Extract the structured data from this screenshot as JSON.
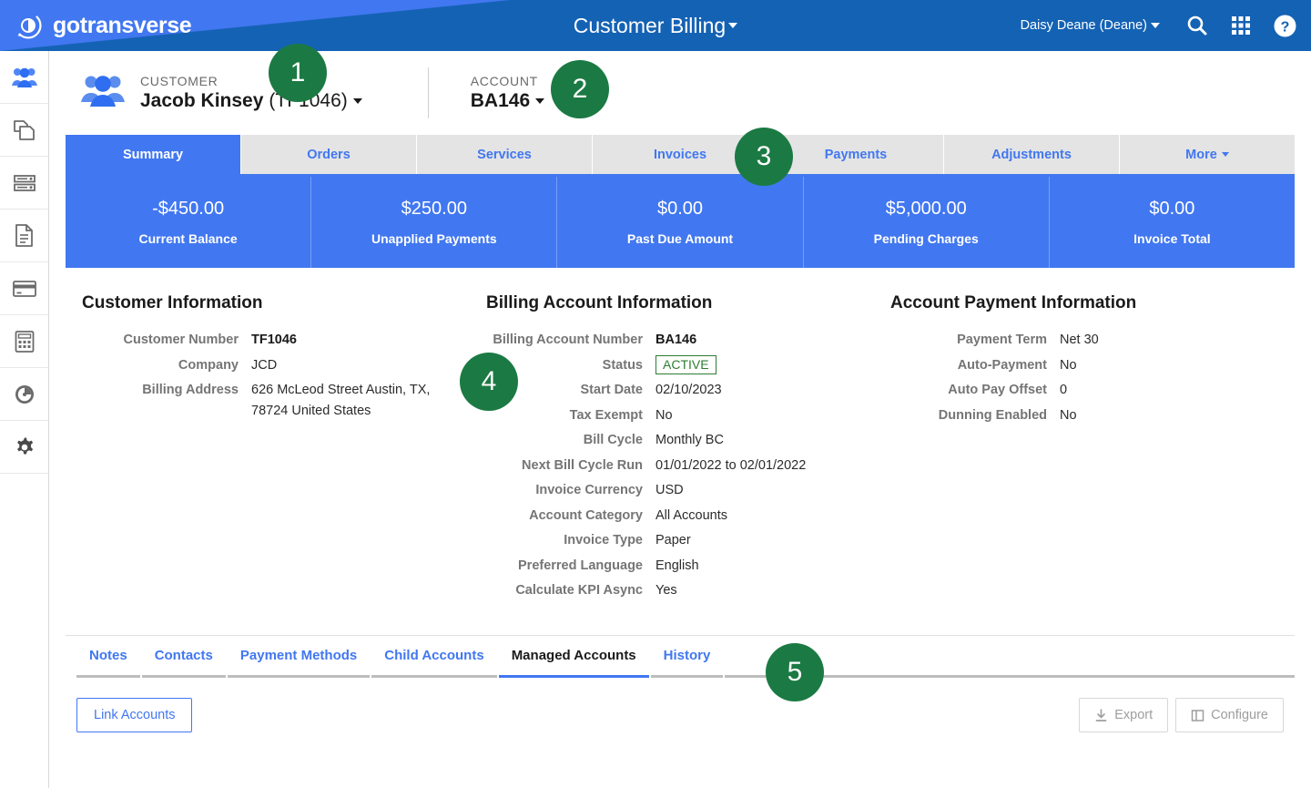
{
  "topbar": {
    "brand": "gotransverse",
    "logo_icon": "gotransverse-circle-logo",
    "app_title": "Customer Billing",
    "user_menu": "Daisy Deane (Deane)",
    "icons": [
      "search-icon",
      "apps-grid-icon",
      "help-icon"
    ]
  },
  "sidebar": {
    "items": [
      {
        "icon": "customers-people-icon",
        "active": true
      },
      {
        "icon": "copy-documents-icon",
        "active": false
      },
      {
        "icon": "server-stack-icon",
        "active": false
      },
      {
        "icon": "document-page-icon",
        "active": false
      },
      {
        "icon": "credit-card-icon",
        "active": false
      },
      {
        "icon": "calculator-icon",
        "active": false
      },
      {
        "icon": "gauge-dashboard-icon",
        "active": false
      },
      {
        "icon": "gear-settings-icon",
        "active": false
      }
    ]
  },
  "entity_bar": {
    "icon": "customer-group-icon",
    "customer_label": "CUSTOMER",
    "customer_name": "Jacob Kinsey",
    "customer_number_paren": "(TF1046)",
    "account_label": "ACCOUNT",
    "account_value": "BA146"
  },
  "tabs": [
    {
      "label": "Summary",
      "active": true
    },
    {
      "label": "Orders",
      "active": false
    },
    {
      "label": "Services",
      "active": false
    },
    {
      "label": "Invoices",
      "active": false
    },
    {
      "label": "Payments",
      "active": false
    },
    {
      "label": "Adjustments",
      "active": false
    },
    {
      "label": "More",
      "active": false,
      "has_caret": true
    }
  ],
  "kpis": [
    {
      "value": "-$450.00",
      "label": "Current Balance"
    },
    {
      "value": "$250.00",
      "label": "Unapplied Payments"
    },
    {
      "value": "$0.00",
      "label": "Past Due Amount"
    },
    {
      "value": "$5,000.00",
      "label": "Pending Charges"
    },
    {
      "value": "$0.00",
      "label": "Invoice Total"
    }
  ],
  "customer_information": {
    "heading": "Customer Information",
    "rows": [
      {
        "key": "Customer Number",
        "value": "TF1046",
        "bold": true
      },
      {
        "key": "Company",
        "value": "JCD"
      },
      {
        "key": "Billing Address",
        "value": "626 McLeod Street Austin, TX, 78724 United States"
      }
    ]
  },
  "billing_account_information": {
    "heading": "Billing Account Information",
    "rows": [
      {
        "key": "Billing Account Number",
        "value": "BA146",
        "bold": true
      },
      {
        "key": "Status",
        "value": "ACTIVE",
        "badge": true
      },
      {
        "key": "Start Date",
        "value": "02/10/2023"
      },
      {
        "key": "Tax Exempt",
        "value": "No"
      },
      {
        "key": "Bill Cycle",
        "value": "Monthly BC"
      },
      {
        "key": "Next Bill Cycle Run",
        "value": "01/01/2022 to 02/01/2022"
      },
      {
        "key": "Invoice Currency",
        "value": "USD"
      },
      {
        "key": "Account Category",
        "value": "All Accounts"
      },
      {
        "key": "Invoice Type",
        "value": "Paper"
      },
      {
        "key": "Preferred Language",
        "value": "English"
      },
      {
        "key": "Calculate KPI Async",
        "value": "Yes"
      }
    ]
  },
  "account_payment_information": {
    "heading": "Account Payment Information",
    "rows": [
      {
        "key": "Payment Term",
        "value": "Net 30"
      },
      {
        "key": "Auto-Payment",
        "value": "No"
      },
      {
        "key": "Auto Pay Offset",
        "value": "0"
      },
      {
        "key": "Dunning Enabled",
        "value": "No"
      }
    ]
  },
  "subtabs": [
    {
      "label": "Notes",
      "active": false
    },
    {
      "label": "Contacts",
      "active": false
    },
    {
      "label": "Payment Methods",
      "active": false
    },
    {
      "label": "Child Accounts",
      "active": false
    },
    {
      "label": "Managed Accounts",
      "active": true
    },
    {
      "label": "History",
      "active": false
    }
  ],
  "actions": {
    "link_accounts": "Link Accounts",
    "export": "Export",
    "export_icon": "download-icon",
    "configure": "Configure",
    "configure_icon": "columns-icon"
  },
  "callouts": [
    {
      "number": "1"
    },
    {
      "number": "2"
    },
    {
      "number": "3"
    },
    {
      "number": "4"
    },
    {
      "number": "5"
    }
  ],
  "colors": {
    "header_dark_blue": "#1462b4",
    "header_light_blue": "#4177f0",
    "accent_blue": "#4177f0",
    "badge_green": "#1b7a43",
    "status_green": "#2d7d32"
  }
}
